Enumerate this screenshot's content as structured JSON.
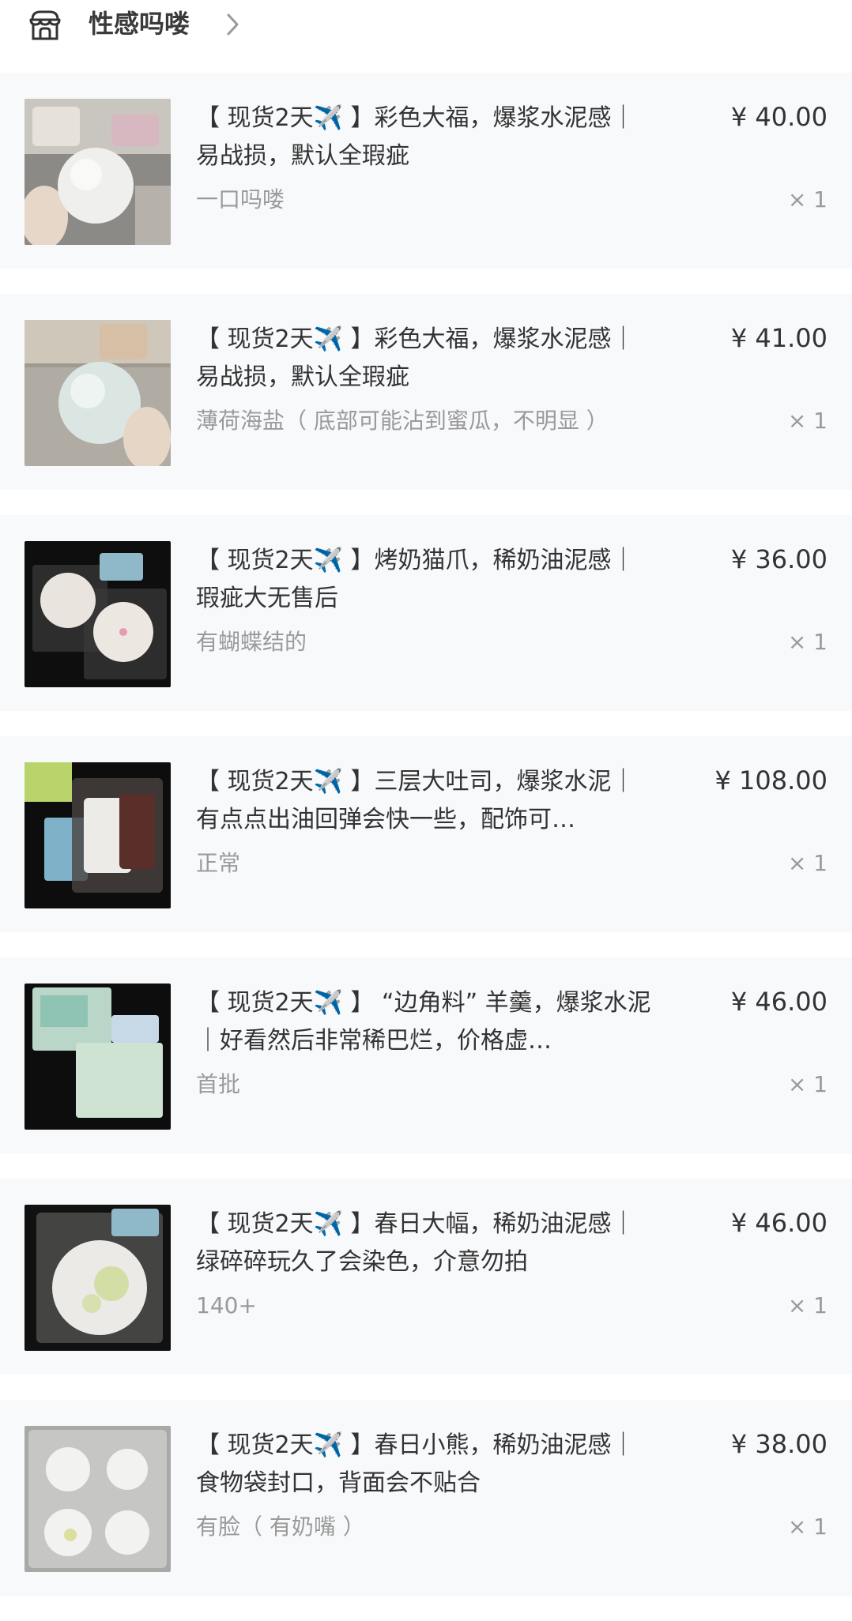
{
  "shop": {
    "name": "性感吗喽",
    "icon": "shop-icon",
    "chevron_icon": "chevron-right-icon"
  },
  "items": [
    {
      "title": "【 现货2天✈️ 】彩色大福，爆浆水泥感｜易战损，默认全瑕疵",
      "variant": "一口吗喽",
      "price": "¥ 40.00",
      "qty": "× 1"
    },
    {
      "title": "【 现货2天✈️ 】彩色大福，爆浆水泥感｜易战损，默认全瑕疵",
      "variant": "薄荷海盐（ 底部可能沾到蜜瓜，不明显 ）",
      "price": "¥ 41.00",
      "qty": "× 1"
    },
    {
      "title": "【 现货2天✈️ 】烤奶猫爪，稀奶油泥感｜瑕疵大无售后",
      "variant": "有蝴蝶结的",
      "price": "¥ 36.00",
      "qty": "× 1"
    },
    {
      "title": "【 现货2天✈️ 】三层大吐司，爆浆水泥｜有点点出油回弹会快一些，配饰可…",
      "variant": "正常",
      "price": "¥ 108.00",
      "qty": "× 1"
    },
    {
      "title": "【 现货2天✈️ 】 “边角料” 羊羹，爆浆水泥｜好看然后非常稀巴烂，价格虚…",
      "variant": "首批",
      "price": "¥ 46.00",
      "qty": "× 1"
    },
    {
      "title": "【 现货2天✈️ 】春日大幅，稀奶油泥感｜绿碎碎玩久了会染色，介意勿拍",
      "variant": "140+",
      "price": "¥ 46.00",
      "qty": "× 1"
    },
    {
      "title": "【 现货2天✈️ 】春日小熊，稀奶油泥感｜食物袋封口，背面会不贴合",
      "variant": "有脸（ 有奶嘴 ）",
      "price": "¥ 38.00",
      "qty": "× 1"
    }
  ]
}
